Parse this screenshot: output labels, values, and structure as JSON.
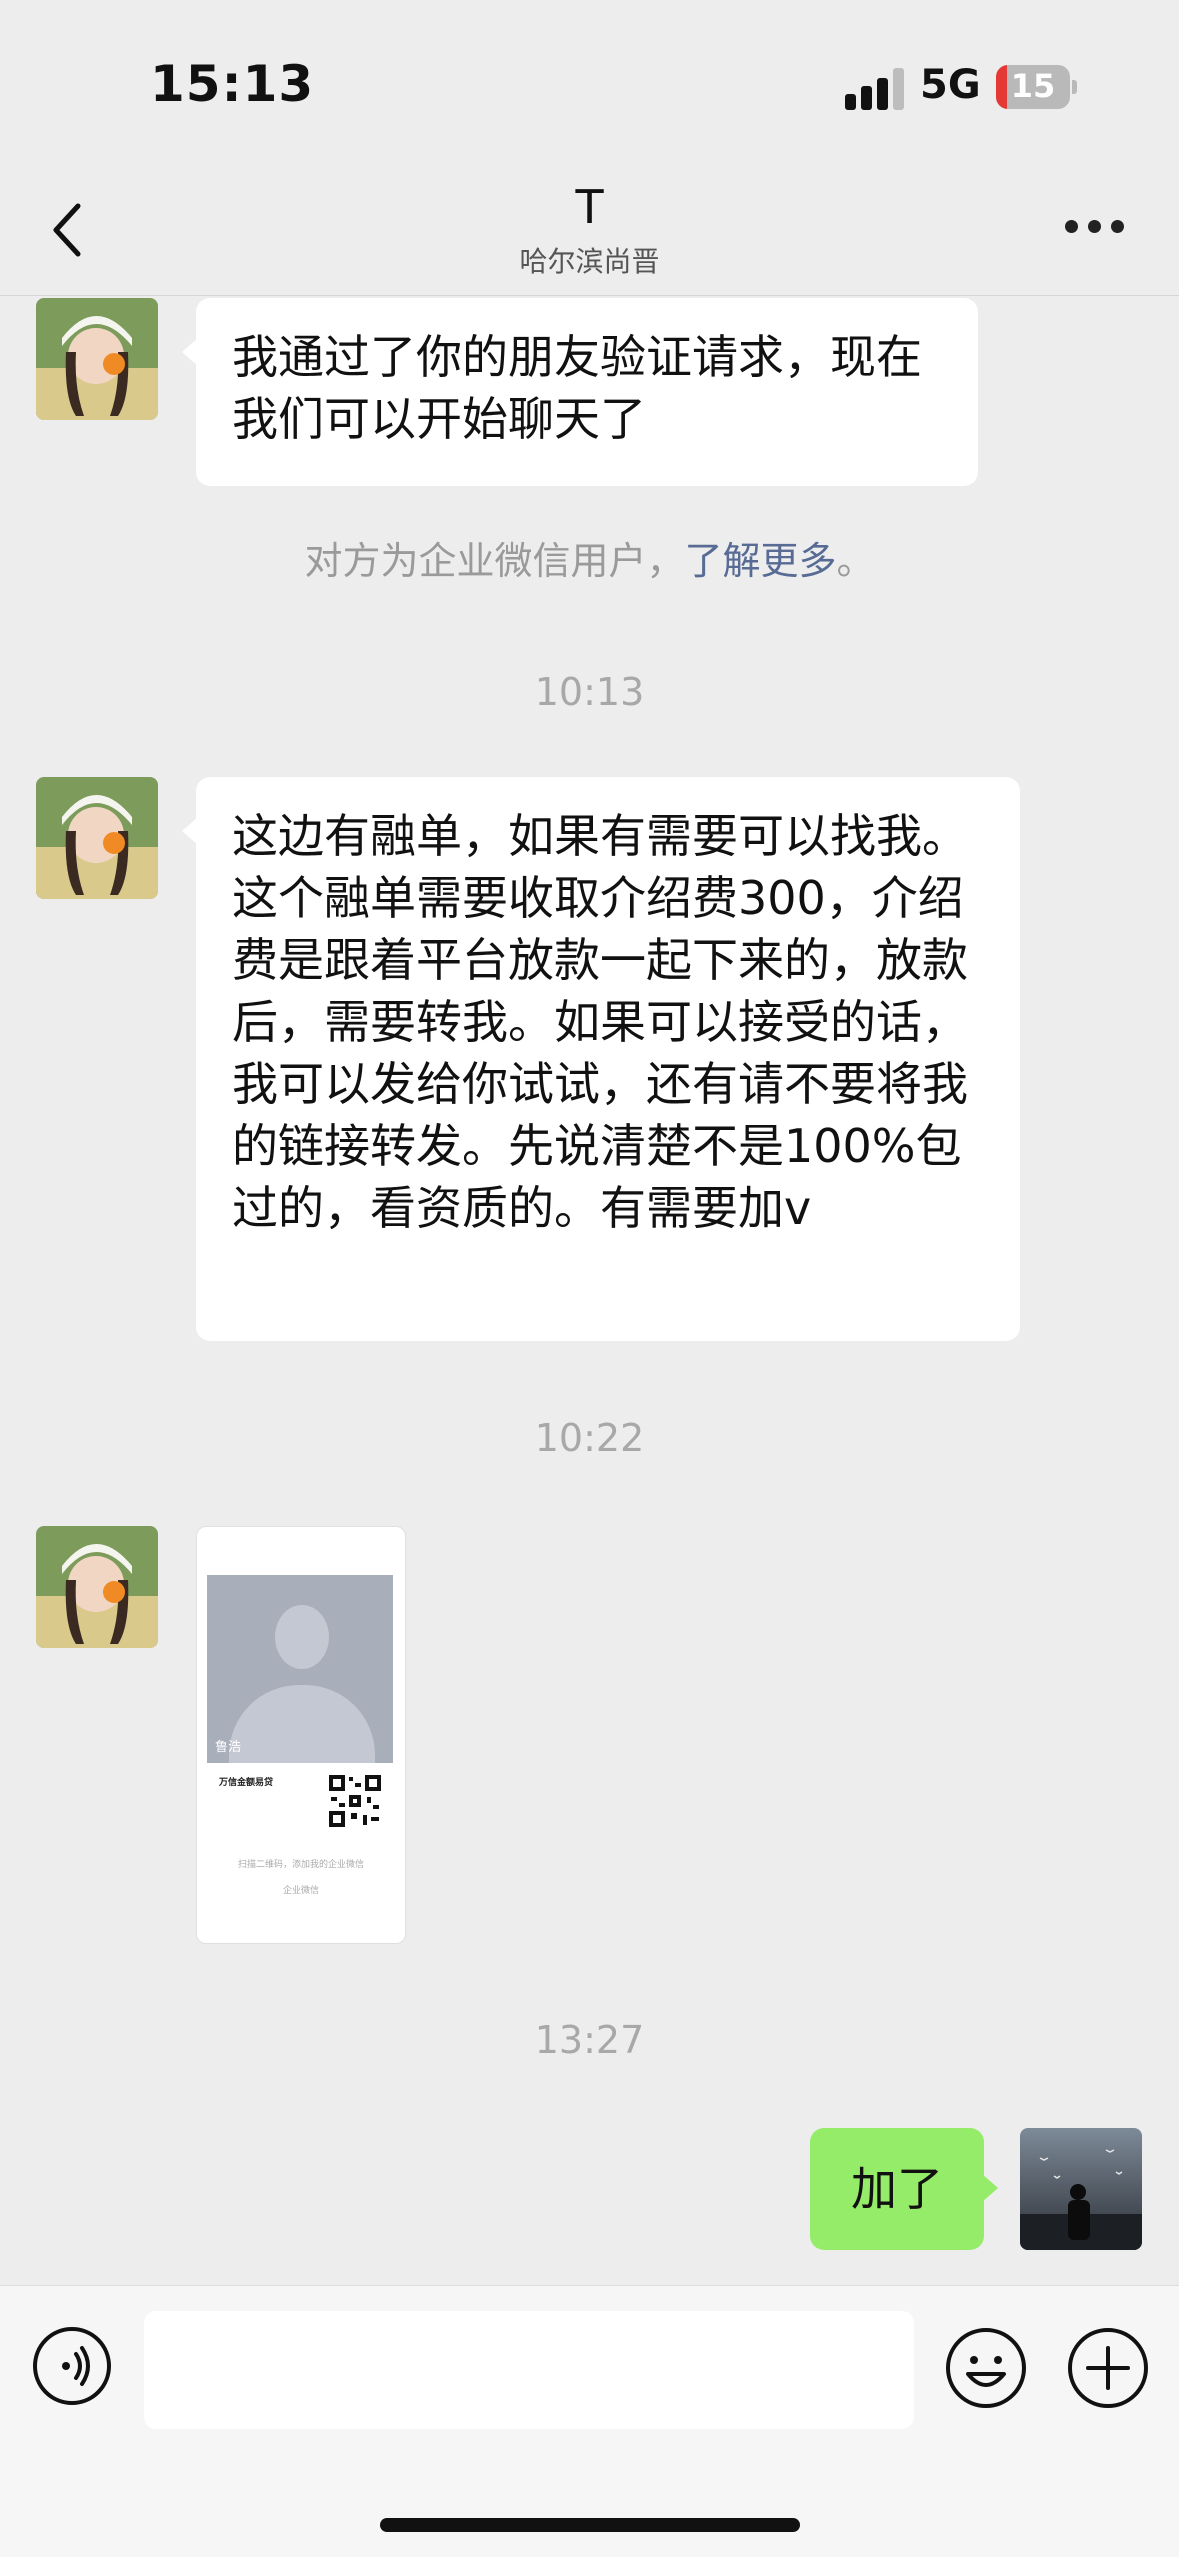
{
  "status_bar": {
    "time": "15:13",
    "network": "5G",
    "battery": "15",
    "battery_level": 0.15,
    "battery_color": "#e53935"
  },
  "header": {
    "back_icon": "chevron-left-icon",
    "title": "T",
    "subtitle": "哈尔滨尚晋",
    "more_icon": "ellipsis-icon"
  },
  "messages": {
    "m1": {
      "text": "我通过了你的朋友验证请求，现在我们可以开始聊天了"
    },
    "notice": {
      "text": "对方为企业微信用户，",
      "link": "了解更多",
      "end": "。"
    },
    "t1": "10:13",
    "m2": {
      "text": "这边有融单，如果有需要可以找我。这个融单需要收取介绍费300，介绍费是跟着平台放款一起下来的，放款后，需要转我。如果可以接受的话，我可以发给你试试，还有请不要将我的链接转发。先说清楚不是100%包过的，看资质的。有需要加v"
    },
    "t2": "10:22",
    "card": {
      "name": "鲁浩",
      "org": "万信金额易贷",
      "hint": "扫描二维码，添加我的企业微信",
      "watermark": "企业微信"
    },
    "t3": "13:27",
    "mine": {
      "text": "加了"
    }
  },
  "bottom_bar": {
    "voice_icon": "voice-icon",
    "emoji_icon": "emoji-icon",
    "plus_icon": "plus-icon",
    "bubble_mine_color": "#95ec69",
    "link_color": "#576b95"
  }
}
